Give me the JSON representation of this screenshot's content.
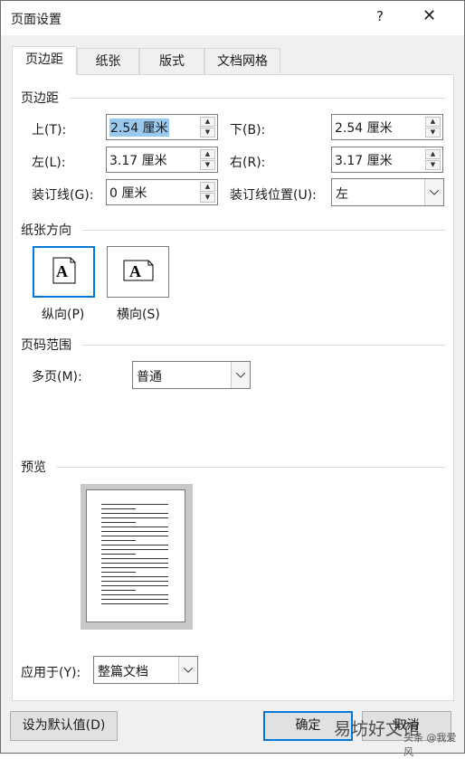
{
  "window": {
    "title": "页面设置",
    "help": "?",
    "close": "✕"
  },
  "tabs": [
    "页边距",
    "纸张",
    "版式",
    "文档网格"
  ],
  "margins": {
    "section": "页边距",
    "top_label": "上(T):",
    "top_value": "2.54 厘米",
    "bottom_label": "下(B):",
    "bottom_value": "2.54 厘米",
    "left_label": "左(L):",
    "left_value": "3.17 厘米",
    "right_label": "右(R):",
    "right_value": "3.17 厘米",
    "gutter_label": "装订线(G):",
    "gutter_value": "0 厘米",
    "gutter_pos_label": "装订线位置(U):",
    "gutter_pos_value": "左"
  },
  "orientation": {
    "section": "纸张方向",
    "portrait": "纵向(P)",
    "landscape": "横向(S)",
    "glyph": "A",
    "selected": "portrait"
  },
  "pages": {
    "section": "页码范围",
    "multiple_label": "多页(M):",
    "multiple_value": "普通"
  },
  "preview": {
    "section": "预览"
  },
  "apply": {
    "label": "应用于(Y):",
    "value": "整篇文档"
  },
  "buttons": {
    "default": "设为默认值(D)",
    "ok": "确定",
    "cancel": "取消"
  },
  "watermark": {
    "text": "易坊好文馆",
    "small": "头条 @我爱风"
  },
  "colors": {
    "accent": "#0078d7",
    "selection": "#99c9ef"
  }
}
